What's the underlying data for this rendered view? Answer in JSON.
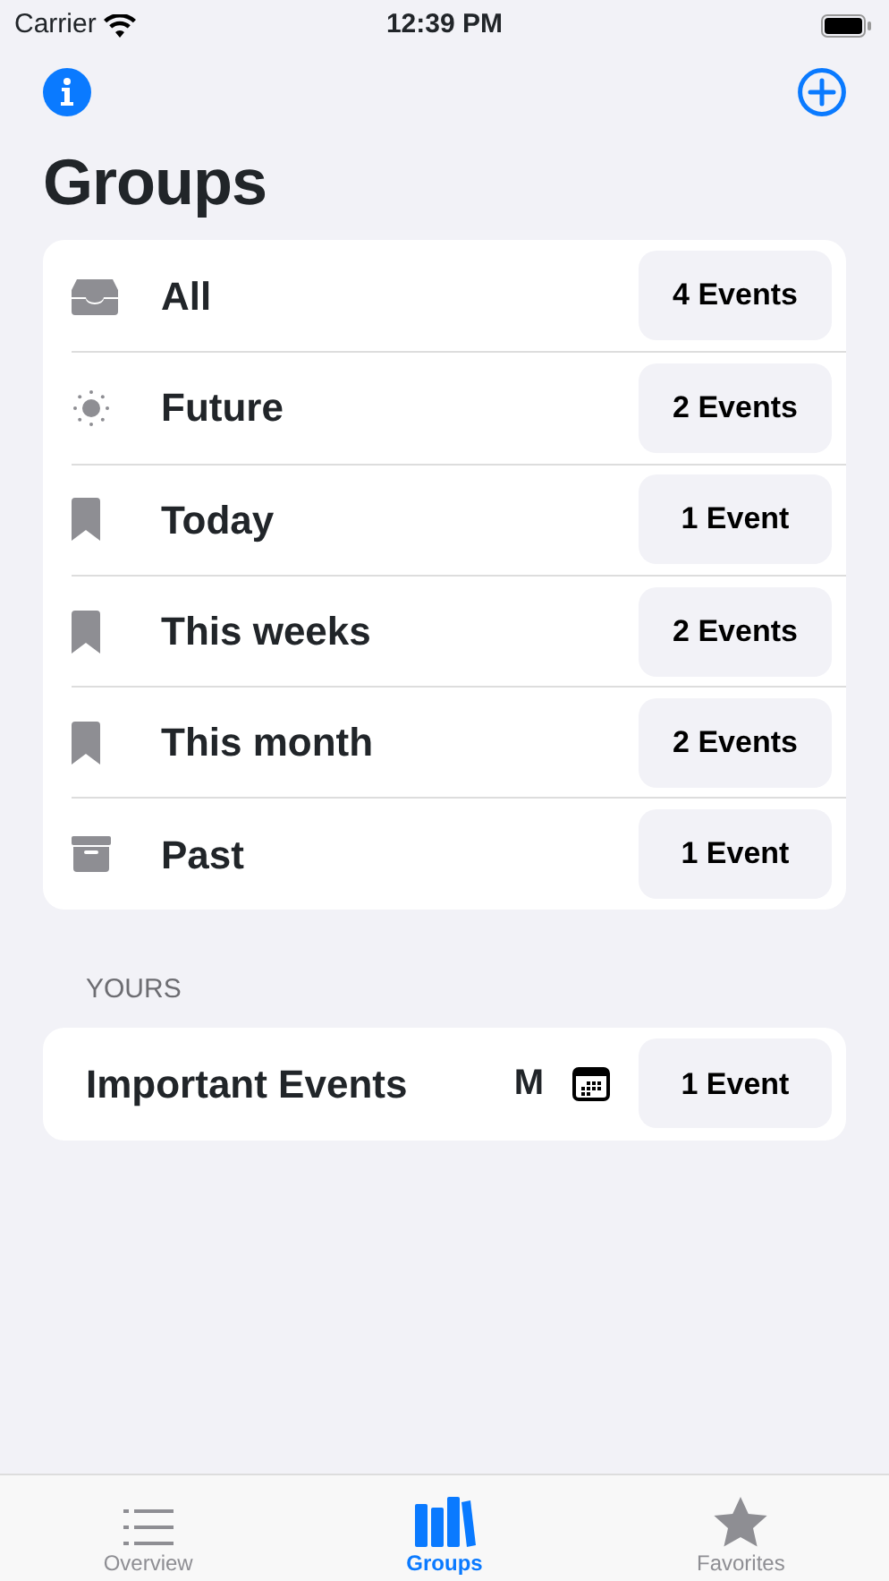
{
  "status_bar": {
    "carrier": "Carrier",
    "time": "12:39 PM"
  },
  "title": "Groups",
  "groups": [
    {
      "kind": "tray",
      "label": "All",
      "count": "4 Events"
    },
    {
      "kind": "sun",
      "label": "Future",
      "count": "2 Events"
    },
    {
      "kind": "bookmark",
      "label": "Today",
      "count": "1 Event"
    },
    {
      "kind": "bookmark",
      "label": "This weeks",
      "count": "2 Events"
    },
    {
      "kind": "bookmark",
      "label": "This month",
      "count": "2 Events"
    },
    {
      "kind": "archive",
      "label": "Past",
      "count": "1 Event"
    }
  ],
  "yours": {
    "header": "YOURS",
    "items": [
      {
        "label": "Important Events",
        "letter": "M",
        "count": "1 Event"
      }
    ]
  },
  "tabs": [
    {
      "kind": "list",
      "label": "Overview",
      "selected": false
    },
    {
      "kind": "books",
      "label": "Groups",
      "selected": true
    },
    {
      "kind": "star",
      "label": "Favorites",
      "selected": false
    }
  ]
}
